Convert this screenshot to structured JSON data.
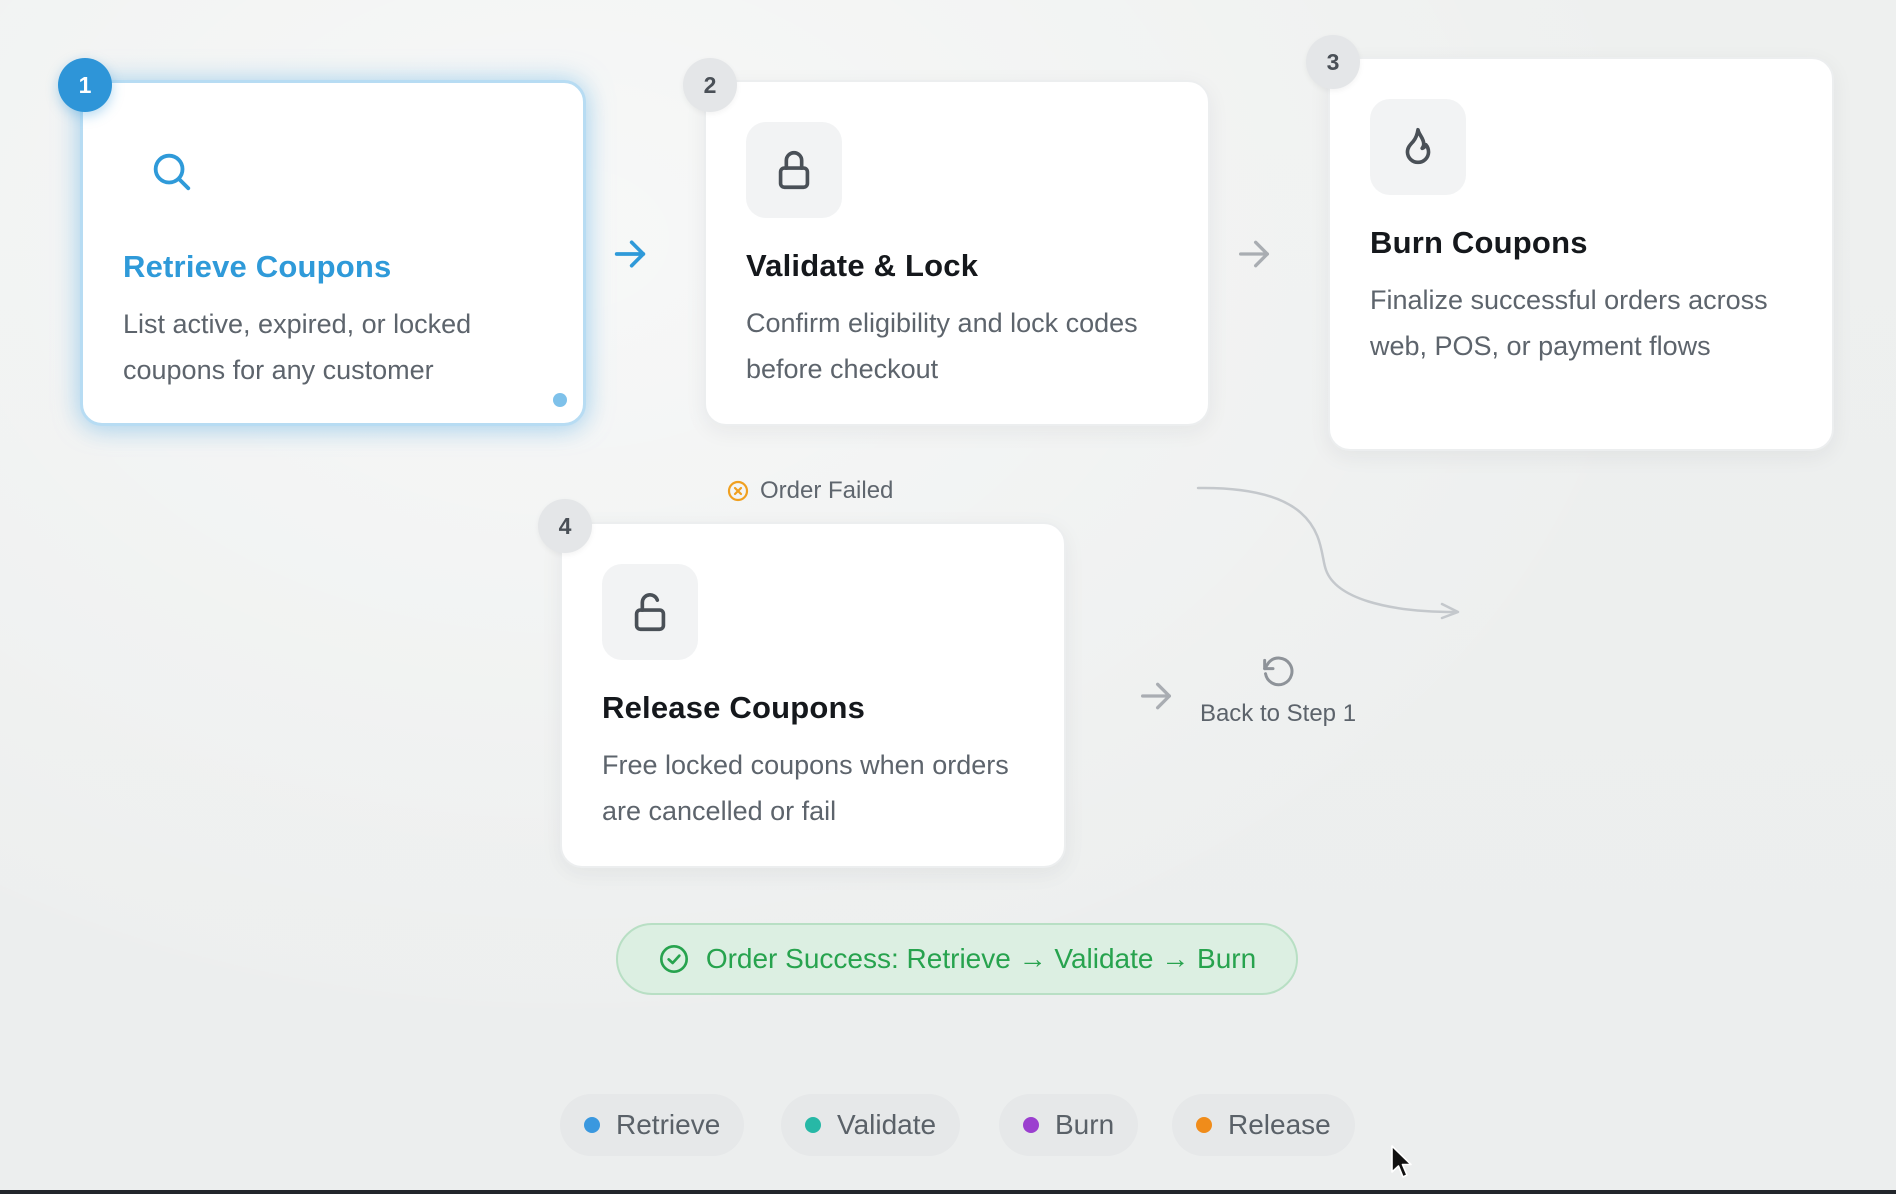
{
  "steps": [
    {
      "number": "1",
      "title": "Retrieve Coupons",
      "description": "List active, expired, or locked coupons for any customer",
      "icon": "search-icon",
      "state": "active"
    },
    {
      "number": "2",
      "title": "Validate & Lock",
      "description": "Confirm eligibility and lock codes before checkout",
      "icon": "lock-icon",
      "state": "inactive"
    },
    {
      "number": "3",
      "title": "Burn Coupons",
      "description": "Finalize successful orders across web, POS, or payment flows",
      "icon": "flame-icon",
      "state": "inactive"
    },
    {
      "number": "4",
      "title": "Release Coupons",
      "description": "Free locked coupons when orders are cancelled or fail",
      "icon": "unlock-icon",
      "state": "inactive"
    }
  ],
  "order_failed": {
    "label": "Order Failed",
    "icon": "x-circle-icon"
  },
  "back_to_step": {
    "label": "Back to Step 1",
    "icon": "rotate-ccw-icon"
  },
  "order_success": {
    "label": "Order Success: Retrieve → Validate → Burn",
    "icon": "check-circle-icon"
  },
  "legend": [
    {
      "label": "Retrieve",
      "color": "#3a98df"
    },
    {
      "label": "Validate",
      "color": "#27b8a6"
    },
    {
      "label": "Burn",
      "color": "#9b3fcf"
    },
    {
      "label": "Release",
      "color": "#f08c1a"
    }
  ],
  "colors": {
    "accent": "#2e95d8",
    "success": "#27a34e",
    "warning": "#f0a020",
    "muted_arrow": "#a9adb2"
  }
}
